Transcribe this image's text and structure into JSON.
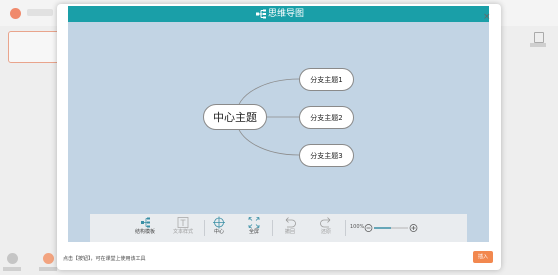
{
  "colors": {
    "accent": "#1a9fa8",
    "canvas": "#c2d4e4",
    "insert_button": "#f2884f"
  },
  "dialog": {
    "title": "思维导图",
    "title_icon": "mindmap-icon",
    "close_label": "×"
  },
  "mindmap": {
    "center": "中心主题",
    "branches": [
      "分支主题1",
      "分支主题2",
      "分支主题3"
    ]
  },
  "toolbar": {
    "items": [
      {
        "label": "结构模板",
        "icon": "structure-template-icon",
        "enabled": true
      },
      {
        "label": "文本样式",
        "icon": "text-style-icon",
        "enabled": false
      },
      {
        "label": "中心",
        "icon": "center-icon",
        "enabled": true
      },
      {
        "label": "全屏",
        "icon": "fullscreen-icon",
        "enabled": true
      },
      {
        "label": "撤回",
        "icon": "undo-icon",
        "enabled": false
      },
      {
        "label": "还原",
        "icon": "redo-icon",
        "enabled": false
      }
    ],
    "zoom": "100%",
    "zoom_level": 0.5
  },
  "footer": {
    "hint": "点击【按钮】，可在课堂上使用该工具",
    "insert_label": "插入"
  }
}
